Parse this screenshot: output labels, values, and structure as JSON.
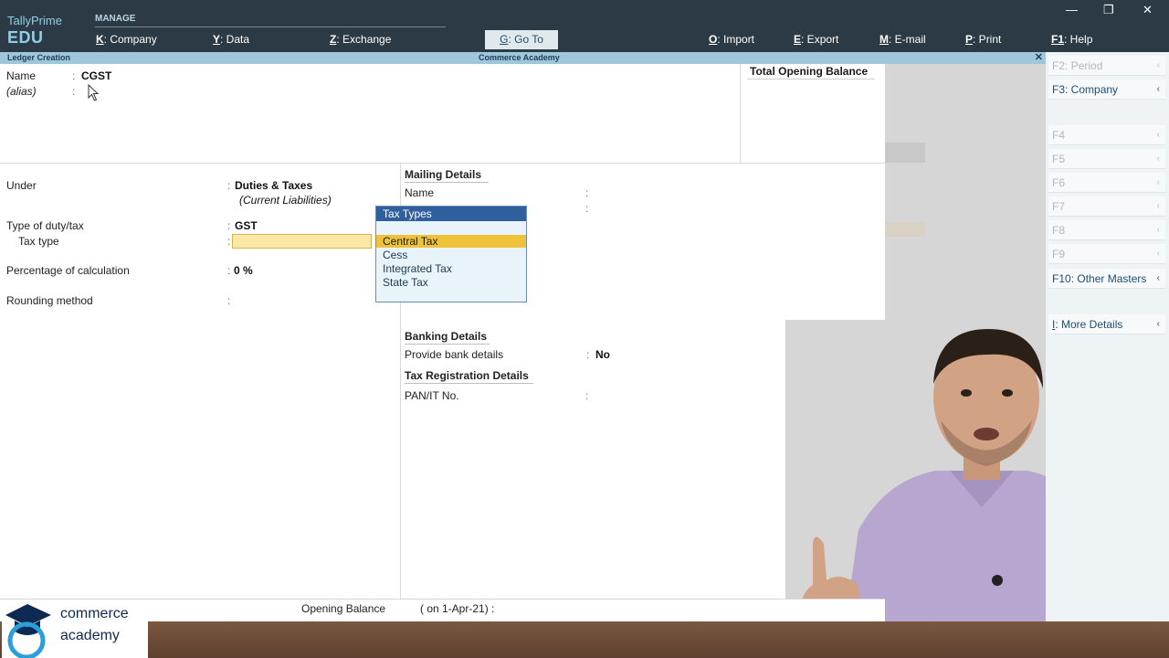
{
  "header": {
    "brand_line1": "TallyPrime",
    "brand_line2": "EDU",
    "manage_label": "MANAGE",
    "menu": [
      {
        "key": "K",
        "label": ": Company"
      },
      {
        "key": "Y",
        "label": ": Data"
      },
      {
        "key": "Z",
        "label": ": Exchange"
      }
    ],
    "goto": {
      "key": "G",
      "label": ": Go To"
    },
    "actions": [
      {
        "key": "O",
        "label": ": Import"
      },
      {
        "key": "E",
        "label": ": Export"
      },
      {
        "key": "M",
        "label": ": E-mail"
      },
      {
        "key": "P",
        "label": ": Print"
      },
      {
        "key": "F1",
        "label": ": Help"
      }
    ],
    "window_controls": {
      "minimize": "—",
      "restore": "❐",
      "close": "✕"
    }
  },
  "title_strip": {
    "screen": "Ledger Creation",
    "company": "Commerce Academy",
    "close": "✕"
  },
  "ledger": {
    "name_label": "Name",
    "name_value": "CGST",
    "alias_label": "(alias)",
    "total_opening_balance_label": "Total Opening Balance",
    "under_label": "Under",
    "under_value": "Duties & Taxes",
    "under_group": "(Current Liabilities)",
    "type_of_duty_label": "Type of duty/tax",
    "type_of_duty_value": "GST",
    "tax_type_label": "Tax type",
    "percentage_label": "Percentage of calculation",
    "percentage_value": "0 %",
    "rounding_label": "Rounding method"
  },
  "mailing": {
    "title": "Mailing Details",
    "name_label": "Name"
  },
  "banking": {
    "title": "Banking Details",
    "provide_label": "Provide bank details",
    "provide_value": "No"
  },
  "tax_registration": {
    "title": "Tax Registration Details",
    "pan_label": "PAN/IT No."
  },
  "popup": {
    "title": "Tax Types",
    "options": [
      "Central Tax",
      "Cess",
      "Integrated Tax",
      "State Tax"
    ],
    "selected": "Central Tax"
  },
  "right_bar": [
    {
      "key": "F2",
      "label": ": Period",
      "active": false
    },
    {
      "key": "F3",
      "label": ": Company",
      "active": true
    },
    {
      "key": "F4",
      "label": "",
      "active": false
    },
    {
      "key": "F5",
      "label": "",
      "active": false
    },
    {
      "key": "F6",
      "label": "",
      "active": false
    },
    {
      "key": "F7",
      "label": "",
      "active": false
    },
    {
      "key": "F8",
      "label": "",
      "active": false
    },
    {
      "key": "F9",
      "label": "",
      "active": false
    },
    {
      "key": "F10",
      "label": ": Other Masters",
      "active": true
    },
    {
      "key": "I",
      "label": ": More Details",
      "active": true
    }
  ],
  "footer": {
    "opening_balance_label": "Opening Balance",
    "opening_balance_date": "( on 1-Apr-21) :"
  },
  "logo": {
    "line1": "commerce",
    "line2": "academy"
  },
  "colors": {
    "topbar": "#2b3a44",
    "title_strip": "#9ec7dc",
    "popup_header": "#2f5f9e",
    "selection": "#efc23a",
    "field_highlight": "#fbe8a6"
  }
}
